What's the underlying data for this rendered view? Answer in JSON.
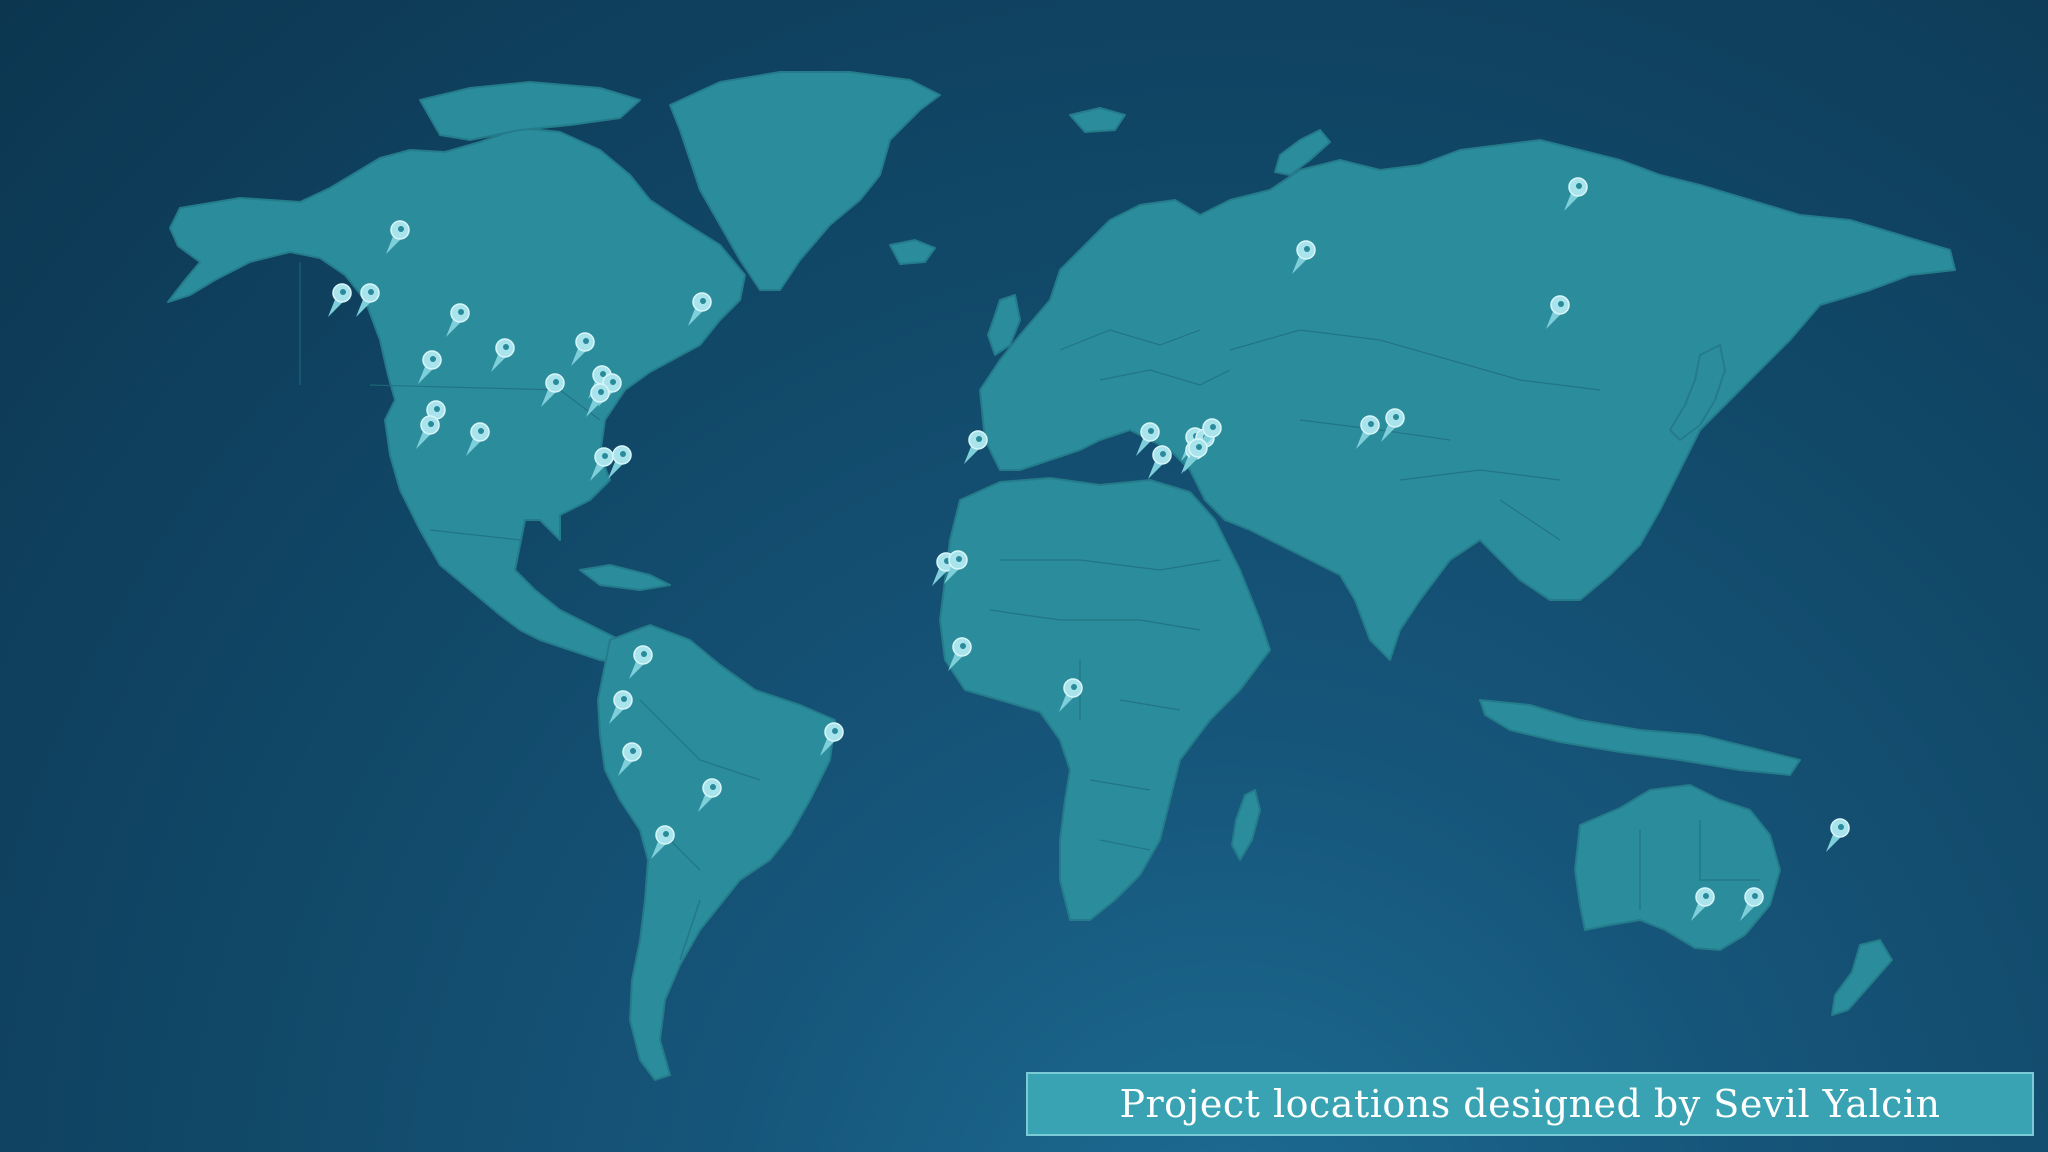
{
  "caption": {
    "text": "Project locations designed by Sevil Yalcin"
  },
  "colors": {
    "ocean_dark": "#0c3650",
    "ocean_light": "#1d6d93",
    "land": "#2b8c9c",
    "pin": "#a9e4ec",
    "caption_box": "#3aa3b3"
  },
  "marker_icon": "map-pin-icon"
}
